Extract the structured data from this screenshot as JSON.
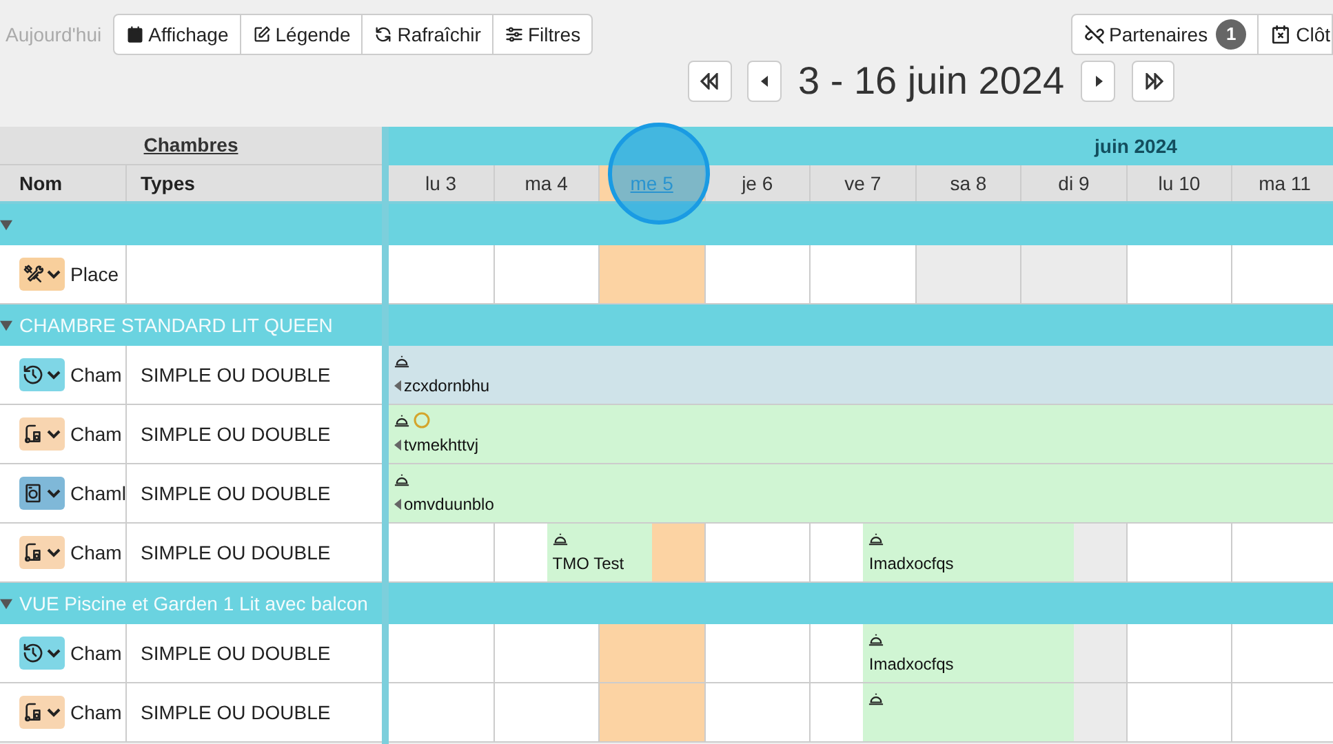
{
  "toolbar": {
    "today": {
      "label": "Aujourd'hui",
      "disabled": true
    },
    "buttons": [
      {
        "kind": "calendar",
        "label": "Affichage"
      },
      {
        "kind": "edit",
        "label": "Légende"
      },
      {
        "kind": "refresh",
        "label": "Rafraîchir"
      },
      {
        "kind": "sliders",
        "label": "Filtres"
      }
    ],
    "right_buttons": [
      {
        "kind": "unlink",
        "label": "Partenaires",
        "badge": "1"
      },
      {
        "kind": "calendar-x",
        "label": "Clôt"
      }
    ]
  },
  "period": {
    "title": "3 - 16 juin 2024"
  },
  "header": {
    "left_title": "Chambres",
    "columns": [
      "Nom",
      "Types"
    ],
    "month": "juin 2024"
  },
  "days": [
    {
      "label": "lu 3",
      "kind": "weekday"
    },
    {
      "label": "ma 4",
      "kind": "weekday"
    },
    {
      "label": "me 5",
      "kind": "today"
    },
    {
      "label": "je 6",
      "kind": "weekday"
    },
    {
      "label": "ve 7",
      "kind": "weekday"
    },
    {
      "label": "sa 8",
      "kind": "weekend"
    },
    {
      "label": "di 9",
      "kind": "weekend"
    },
    {
      "label": "lu 10",
      "kind": "weekday"
    },
    {
      "label": "ma 11",
      "kind": "weekday"
    }
  ],
  "rows": [
    {
      "kind": "group",
      "label": "",
      "expanded": true
    },
    {
      "kind": "room",
      "icon": {
        "kind": "tools"
      },
      "name": "Place",
      "type": "",
      "cells": [
        {
          "kind": "free"
        },
        {
          "kind": "free"
        },
        {
          "kind": "free"
        },
        {
          "kind": "free"
        },
        {
          "kind": "free"
        },
        {
          "kind": "free"
        },
        {
          "kind": "free"
        },
        {
          "kind": "free"
        },
        {
          "kind": "free"
        }
      ]
    },
    {
      "kind": "group",
      "label": "CHAMBRE STANDARD LIT QUEEN",
      "expanded": true
    },
    {
      "kind": "room",
      "icon": {
        "kind": "history"
      },
      "name": "Cham",
      "type": "SIMPLE OU DOUBLE",
      "cells": [
        {
          "kind": "occupied",
          "booking": {
            "name": "zcxdornbhu",
            "color": "#cfe3e9",
            "continues_before": true,
            "circle": false
          }
        },
        {
          "kind": "occupied"
        },
        {
          "kind": "occupied"
        },
        {
          "kind": "occupied"
        },
        {
          "kind": "occupied"
        },
        {
          "kind": "occupied"
        },
        {
          "kind": "occupied"
        },
        {
          "kind": "occupied"
        },
        {
          "kind": "occupied"
        }
      ]
    },
    {
      "kind": "room",
      "icon": {
        "kind": "cleaning"
      },
      "name": "Cham",
      "type": "SIMPLE OU DOUBLE",
      "cells": [
        {
          "kind": "occupied",
          "booking": {
            "name": "tvmekhttvj",
            "color": "#d0f5d3",
            "continues_before": true,
            "circle": true
          }
        },
        {
          "kind": "occupied"
        },
        {
          "kind": "occupied"
        },
        {
          "kind": "occupied"
        },
        {
          "kind": "occupied"
        },
        {
          "kind": "occupied"
        },
        {
          "kind": "occupied"
        },
        {
          "kind": "occupied"
        },
        {
          "kind": "occupied"
        }
      ]
    },
    {
      "kind": "room",
      "icon": {
        "kind": "laundry"
      },
      "name": "Chaml",
      "type": "SIMPLE OU DOUBLE",
      "cells": [
        {
          "kind": "occupied",
          "booking": {
            "name": "omvduunblo",
            "color": "#d0f5d3",
            "continues_before": true,
            "circle": false
          }
        },
        {
          "kind": "occupied"
        },
        {
          "kind": "occupied"
        },
        {
          "kind": "occupied"
        },
        {
          "kind": "occupied"
        },
        {
          "kind": "occupied"
        },
        {
          "kind": "occupied"
        },
        {
          "kind": "occupied"
        },
        {
          "kind": "occupied"
        }
      ]
    },
    {
      "kind": "room",
      "icon": {
        "kind": "cleaning"
      },
      "name": "Cham",
      "type": "SIMPLE OU DOUBLE",
      "cells": [
        {
          "kind": "free"
        },
        {
          "kind": "arrival",
          "booking": {
            "name": "TMO Test",
            "color": "#d0f5d3",
            "continues_before": false,
            "circle": false
          }
        },
        {
          "kind": "departure"
        },
        {
          "kind": "free"
        },
        {
          "kind": "arrival",
          "booking": {
            "name": "Imadxocfqs",
            "color": "#d0f5d3",
            "continues_before": false,
            "circle": false
          }
        },
        {
          "kind": "occupied"
        },
        {
          "kind": "departure"
        },
        {
          "kind": "free"
        },
        {
          "kind": "free"
        }
      ]
    },
    {
      "kind": "group",
      "label": "VUE Piscine et Garden 1 Lit avec balcon",
      "expanded": true
    },
    {
      "kind": "room",
      "icon": {
        "kind": "history"
      },
      "name": "Cham",
      "type": "SIMPLE OU DOUBLE",
      "cells": [
        {
          "kind": "free"
        },
        {
          "kind": "free"
        },
        {
          "kind": "free"
        },
        {
          "kind": "free"
        },
        {
          "kind": "arrival",
          "booking": {
            "name": "Imadxocfqs",
            "color": "#d0f5d3",
            "continues_before": false,
            "circle": false
          }
        },
        {
          "kind": "occupied"
        },
        {
          "kind": "departure"
        },
        {
          "kind": "free"
        },
        {
          "kind": "free"
        }
      ]
    },
    {
      "kind": "room",
      "icon": {
        "kind": "cleaning"
      },
      "name": "Cham",
      "type": "SIMPLE OU DOUBLE",
      "cells": [
        {
          "kind": "free"
        },
        {
          "kind": "free"
        },
        {
          "kind": "free"
        },
        {
          "kind": "free"
        },
        {
          "kind": "arrival",
          "booking": {
            "color": "#d0f5d3",
            "continues_before": false,
            "circle": false
          }
        },
        {
          "kind": "occupied"
        },
        {
          "kind": "departure"
        },
        {
          "kind": "free"
        },
        {
          "kind": "free"
        }
      ]
    }
  ]
}
